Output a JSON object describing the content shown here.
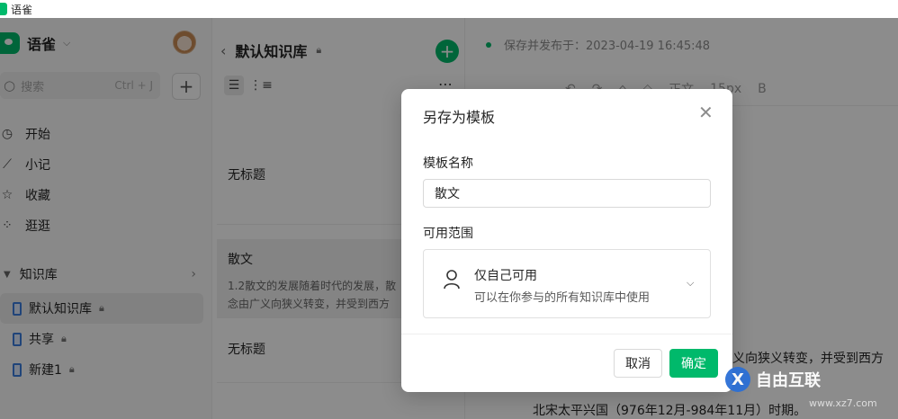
{
  "window": {
    "title": "语雀"
  },
  "sidebar": {
    "brand": "语雀",
    "search": {
      "placeholder": "搜索",
      "shortcut": "Ctrl + J"
    },
    "nav": [
      {
        "label": "开始",
        "icon": "clock-icon"
      },
      {
        "label": "小记",
        "icon": "feather-icon"
      },
      {
        "label": "收藏",
        "icon": "star-icon"
      },
      {
        "label": "逛逛",
        "icon": "grid-icon"
      }
    ],
    "kb_section": "知识库",
    "kb_items": [
      {
        "label": "默认知识库",
        "active": true
      },
      {
        "label": "共享",
        "active": false
      },
      {
        "label": "新建1",
        "active": false
      }
    ]
  },
  "list": {
    "title": "默认知识库",
    "docs": [
      {
        "title": "无标题",
        "excerpt": ""
      },
      {
        "title": "散文",
        "excerpt_line1": "1.2散文的发展随着时代的发展，散",
        "excerpt_line2": "念由广义向狭义转变，并受到西方"
      },
      {
        "title": "无标题",
        "excerpt": ""
      }
    ]
  },
  "editor": {
    "save_status": "保存并发布于：2023-04-19 16:45:48",
    "toolbar": {
      "style": "正文",
      "font_size": "15px",
      "bold": "B"
    },
    "body_line1": "义向狭义转变，并受到西方",
    "body_line2": "北宋太平兴国（976年12月-984年11月）时期。"
  },
  "modal": {
    "title": "另存为模板",
    "name_label": "模板名称",
    "name_value": "散文",
    "scope_label": "可用范围",
    "scope_option": "仅自己可用",
    "scope_desc": "可以在你参与的所有知识库中使用",
    "cancel": "取消",
    "ok": "确定"
  },
  "watermark": {
    "text": "自由互联",
    "sub": "www.xz7.com"
  },
  "colors": {
    "accent": "#00b96b",
    "overlay": "rgba(0,0,0,0.45)"
  }
}
